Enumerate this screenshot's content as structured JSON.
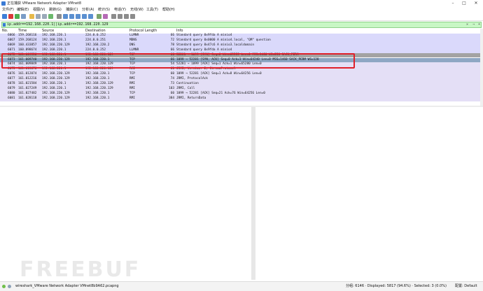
{
  "window": {
    "title": "正在捕获 VMware Network Adapter VMnet8"
  },
  "menu": [
    "文件(F)",
    "编辑(E)",
    "视图(V)",
    "跳转(G)",
    "捕获(C)",
    "分析(A)",
    "统计(S)",
    "电话(Y)",
    "无线(W)",
    "工具(T)",
    "帮助(H)"
  ],
  "filter": {
    "value": "ip.addr==192.168.220.1||ip.addr==192.168.220.129"
  },
  "columns": [
    "No.",
    "Time",
    "Source",
    "Destination",
    "Protocol",
    "Length",
    "Info"
  ],
  "packets": [
    {
      "no": "6066",
      "time": "159.268116",
      "src": "192.168.220.1",
      "dst": "224.0.0.252",
      "proto": "LLMNR",
      "len": "66",
      "info": "Standard query 0x9fda A minio4",
      "bg": "#dad9fb"
    },
    {
      "no": "6067",
      "time": "159.268124",
      "src": "192.168.220.1",
      "dst": "224.0.0.251",
      "proto": "MDNS",
      "len": "72",
      "info": "Standard query 0x0000 A minio4.local, \"QM\" question",
      "bg": "#dad9fb"
    },
    {
      "no": "6069",
      "time": "160.433857",
      "src": "192.168.220.129",
      "dst": "192.168.220.2",
      "proto": "DNS",
      "len": "78",
      "info": "Standard query 0x47c6 A minio3.localdomain",
      "bg": "#dad9fb"
    },
    {
      "no": "6071",
      "time": "160.898674",
      "src": "192.168.220.1",
      "dst": "224.0.0.252",
      "proto": "LLMNR",
      "len": "66",
      "info": "Standard query 0x9fda A minio4",
      "bg": "#dad9fb"
    },
    {
      "no": "6072",
      "time": "161.009556",
      "src": "192.168.220.1",
      "dst": "192.168.220.129",
      "proto": "TCP",
      "len": "66",
      "info": "52281 → 1099 [SYN] Seq=0 Win=65535 Len=0 MSS=1460 WS=256 SACK_PERM",
      "bg": "#a3a3a3"
    },
    {
      "no": "6073",
      "time": "161.009740",
      "src": "192.168.220.129",
      "dst": "192.168.220.1",
      "proto": "TCP",
      "len": "66",
      "info": "1099 → 52281 [SYN, ACK] Seq=0 Ack=1 Win=64240 Len=0 MSS=1460 SACK_PERM WS=128",
      "bg": "#8ea7c4"
    },
    {
      "no": "6074",
      "time": "161.009849",
      "src": "192.168.220.1",
      "dst": "192.168.220.129",
      "proto": "TCP",
      "len": "54",
      "info": "52281 → 1099 [ACK] Seq=1 Ack=1 Win=65280 Len=0",
      "bg": "#e4dff6"
    },
    {
      "no": "6075",
      "time": "161.013676",
      "src": "192.168.220.1",
      "dst": "192.168.220.129",
      "proto": "RMI",
      "len": "61",
      "info": "JRMI, Version: 2, StreamProtocol",
      "bg": "#e4dff6"
    },
    {
      "no": "6076",
      "time": "161.012074",
      "src": "192.168.220.129",
      "dst": "192.168.220.1",
      "proto": "TCP",
      "len": "60",
      "info": "1099 → 52281 [ACK] Seq=1 Ack=8 Win=64256 Len=0",
      "bg": "#e4dff6"
    },
    {
      "no": "6077",
      "time": "161.012216",
      "src": "192.168.220.129",
      "dst": "192.168.220.1",
      "proto": "RMI",
      "len": "74",
      "info": "JRMI, ProtocolAck",
      "bg": "#e4dff6"
    },
    {
      "no": "6078",
      "time": "161.021584",
      "src": "192.168.220.1",
      "dst": "192.168.220.129",
      "proto": "RMI",
      "len": "73",
      "info": "Continuation",
      "bg": "#e4dff6"
    },
    {
      "no": "6079",
      "time": "161.027249",
      "src": "192.168.220.1",
      "dst": "192.168.220.129",
      "proto": "RMI",
      "len": "103",
      "info": "JRMI, Call",
      "bg": "#e4dff6"
    },
    {
      "no": "6080",
      "time": "161.027482",
      "src": "192.168.220.129",
      "dst": "192.168.220.1",
      "proto": "TCP",
      "len": "60",
      "info": "1099 → 52281 [ACK] Seq=21 Ack=76 Win=64256 Len=0",
      "bg": "#e4dff6"
    },
    {
      "no": "6081",
      "time": "161.028118",
      "src": "192.168.220.129",
      "dst": "192.168.220.1",
      "proto": "RMI",
      "len": "384",
      "info": "JRMI, ReturnData",
      "bg": "#e4dff6"
    }
  ],
  "watermark": "FREEBUF",
  "status": {
    "file": "wireshark_VMware Network Adapter VMnet8b9A62.pcapng",
    "counts": "分组: 6146 · Displayed: 5817 (94.6%) · Selected: 3 (0.0%)",
    "profile": "配置: Default"
  }
}
